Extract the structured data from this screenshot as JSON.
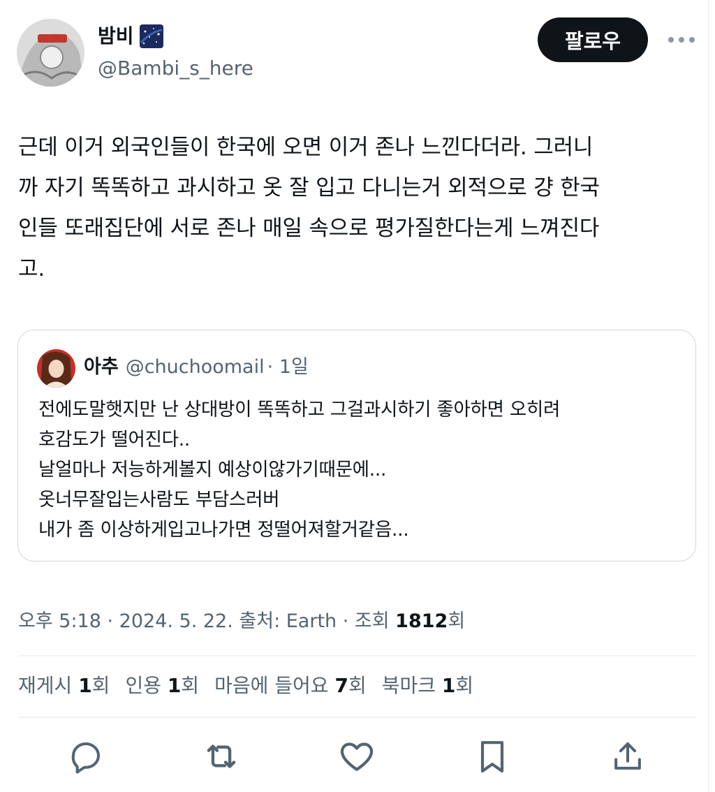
{
  "author": {
    "display_name": "밤비",
    "handle": "@Bambi_s_here"
  },
  "follow_label": "팔로우",
  "more_icon": "more-horizontal-icon",
  "tweet_text": "근데 이거 외국인들이 한국에 오면 이거 존나 느낀다더라. 그러니\n까 자기 똑똑하고 과시하고 옷 잘 입고 다니는거 외적으로 걍 한국\n인들 또래집단에 서로 존나 매일 속으로 평가질한다는게 느껴진다\n고.",
  "quote": {
    "name": "아추",
    "handle": "@chuchoomail",
    "time": "· 1일",
    "text": "전에도말햇지만  난 상대방이 똑똑하고 그걸과시하기 좋아하면 오히려\n호감도가 떨어진다..\n날얼마나 저능하게볼지 예상이않가기때문에...\n옷너무잘입는사람도 부담스러버\n내가 좀 이상하게입고나가면  정떨어져할거같음..."
  },
  "meta": {
    "time": "오후 5:18 · 2024. 5. 22. 출처: Earth · 조회 ",
    "views": "1812",
    "views_suffix": "회"
  },
  "stats": {
    "retweets_label": "재게시 ",
    "retweets": "1",
    "quotes_label": "인용 ",
    "quotes": "1",
    "likes_label": "마음에 들어요 ",
    "likes": "7",
    "bookmarks_label": "북마크 ",
    "bookmarks": "1",
    "unit": "회"
  },
  "actions": [
    "reply-icon",
    "retweet-icon",
    "like-icon",
    "bookmark-icon",
    "share-icon"
  ],
  "colors": {
    "text": "#0f1419",
    "secondary": "#536471",
    "border": "#cfd9de",
    "button": "#0f1419"
  }
}
